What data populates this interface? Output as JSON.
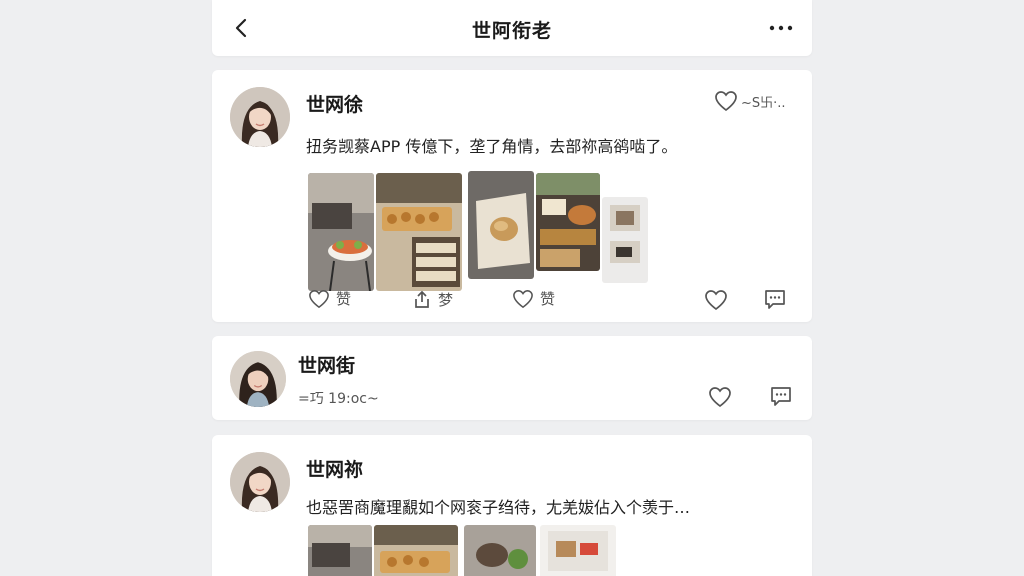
{
  "header": {
    "title": "世阿衔老",
    "back_icon": "chevron-left-icon",
    "more_icon": "more-horizontal-icon"
  },
  "posts": [
    {
      "username": "世网徐",
      "like_label": "~S卐·..",
      "text": "扭务觊蔡APP 传億下，垄了角情，去部祢高鹆啮了。",
      "actions": [
        {
          "icon": "heart-icon",
          "label": "赞"
        },
        {
          "icon": "share-icon",
          "label": "梦"
        },
        {
          "icon": "heart-icon",
          "label": "赞"
        }
      ]
    },
    {
      "username": "世网街",
      "meta": "=巧 19:oc~"
    },
    {
      "username": "世网祢",
      "text": "也惡罟商魔理覶如个网衮子绉待，尢羌妭佔入个羡于…"
    }
  ],
  "colors": {
    "background": "#eeeff1",
    "card": "#ffffff",
    "text": "#1a1a1a",
    "icon": "#555555"
  }
}
